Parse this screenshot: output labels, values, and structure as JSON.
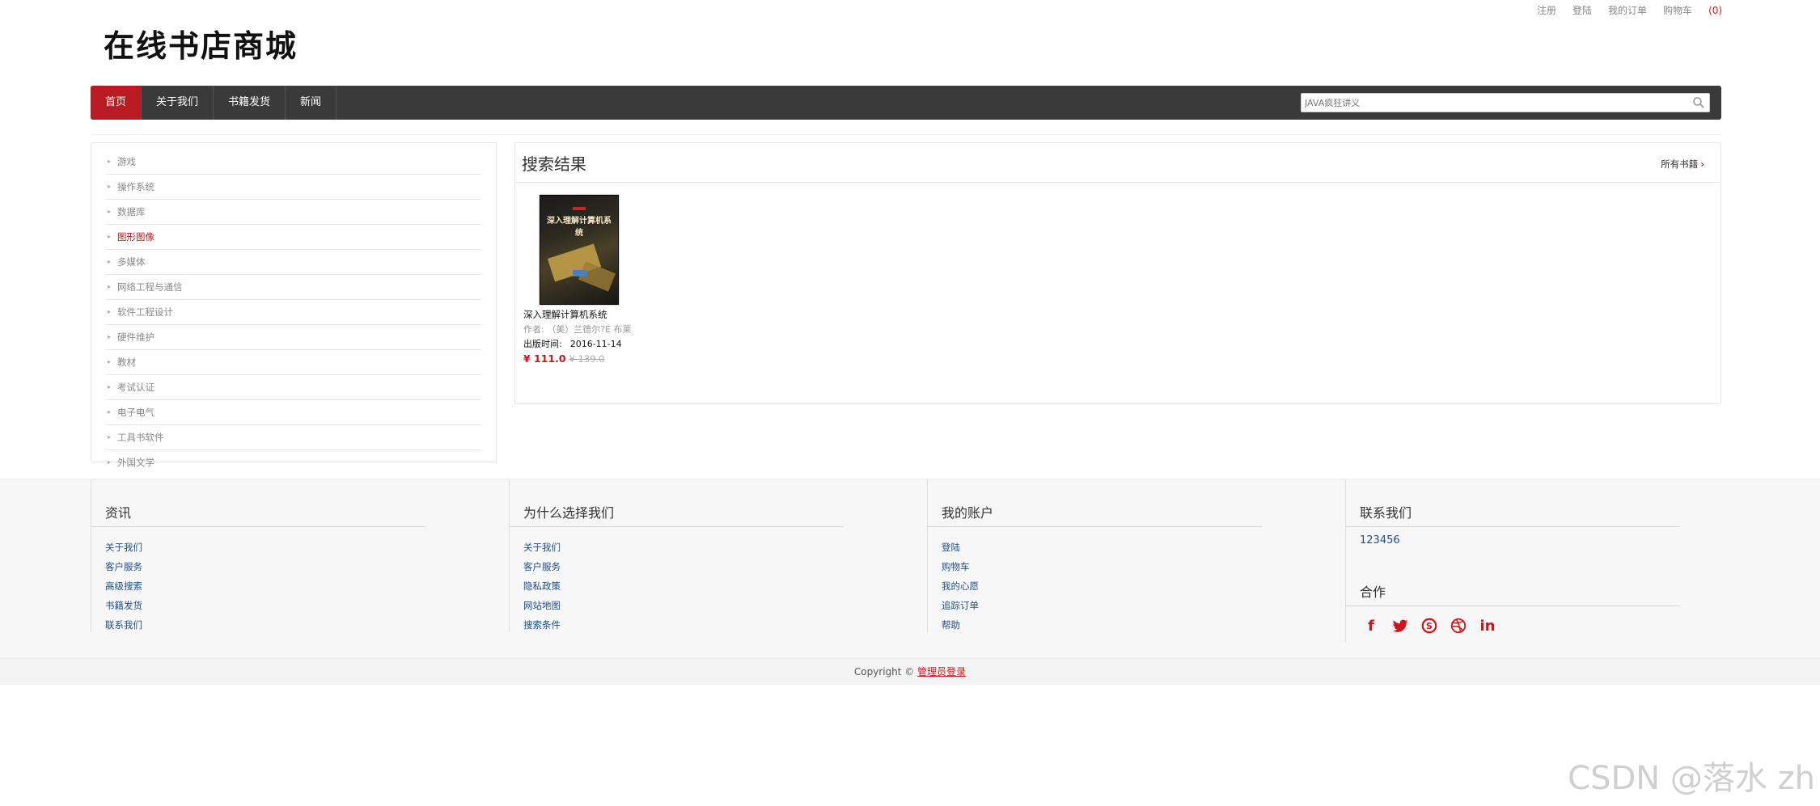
{
  "toplinks": {
    "register": "注册",
    "login": "登陆",
    "orders": "我的订单",
    "cart": "购物车",
    "cart_count": "(0)"
  },
  "logo": "在线书店商城",
  "nav": {
    "items": [
      "首页",
      "关于我们",
      "书籍发货",
      "新闻"
    ],
    "search_placeholder": "JAVA疯狂讲义"
  },
  "sidebar": {
    "categories": [
      "游戏",
      "操作系统",
      "数据库",
      "图形图像",
      "多媒体",
      "网络工程与通信",
      "软件工程设计",
      "硬件维护",
      "教材",
      "考试认证",
      "电子电气",
      "工具书软件",
      "外国文学"
    ],
    "active_index": 3
  },
  "results": {
    "title": "搜索结果",
    "all_books": "所有书籍",
    "book": {
      "cover_title": "深入理解计算机系统",
      "name": "深入理解计算机系统",
      "author_label": "作者:",
      "author": "（美）兰德尔?E 布莱",
      "date_label": "出版时间:",
      "date": "2016-11-14",
      "price": "¥ 111.0",
      "old_price": "¥ 139.0"
    }
  },
  "footer": {
    "col1": {
      "title": "资讯",
      "links": [
        "关于我们",
        "客户服务",
        "高级搜索",
        "书籍发货",
        "联系我们"
      ]
    },
    "col2": {
      "title": "为什么选择我们",
      "links": [
        "关于我们",
        "客户服务",
        "隐私政策",
        "网站地图",
        "搜索条件"
      ]
    },
    "col3": {
      "title": "我的账户",
      "links": [
        "登陆",
        "购物车",
        "我的心愿",
        "追踪订单",
        "帮助"
      ]
    },
    "col4": {
      "title": "联系我们",
      "number": "123456",
      "coop_title": "合作",
      "socials": [
        "facebook-icon",
        "twitter-icon",
        "skype-icon",
        "dribbble-icon",
        "linkedin-icon"
      ]
    }
  },
  "copyright": {
    "text": "Copyright © ",
    "admin": "管理员登录"
  },
  "watermark": "CSDN @落水 zh",
  "colors": {
    "accent": "#b81c22",
    "nav_bg": "#3a3a3a",
    "link": "#1f4d86"
  }
}
